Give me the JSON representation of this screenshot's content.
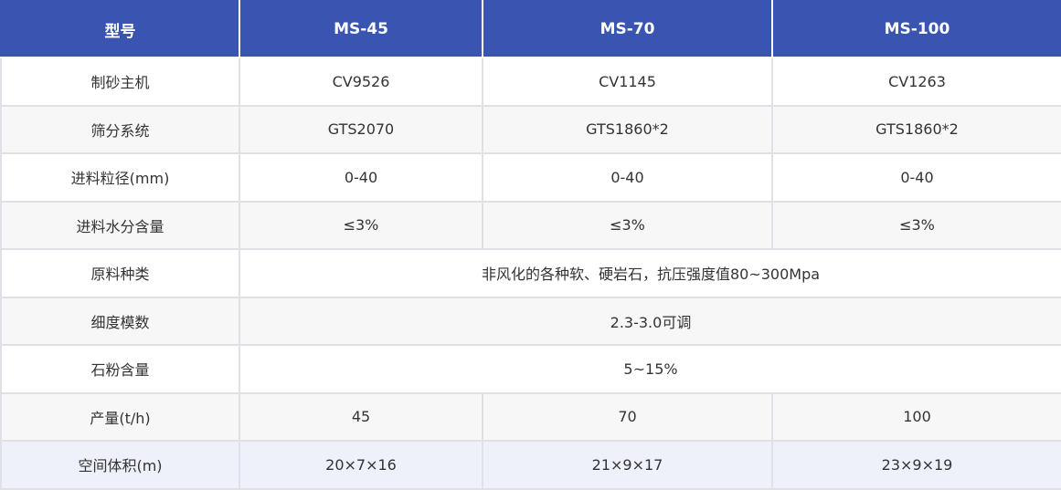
{
  "table": {
    "headers": [
      "型号",
      "MS-45",
      "MS-70",
      "MS-100"
    ],
    "rows": [
      {
        "label": "制砂主机",
        "values": [
          "CV9526",
          "CV1145",
          "CV1263"
        ]
      },
      {
        "label": "筛分系统",
        "values": [
          "GTS2070",
          "GTS1860*2",
          "GTS1860*2"
        ]
      },
      {
        "label": "进料粒径(mm)",
        "values": [
          "0-40",
          "0-40",
          "0-40"
        ]
      },
      {
        "label": "进料水分含量",
        "values": [
          "≤3%",
          "≤3%",
          "≤3%"
        ]
      },
      {
        "label": "原料种类",
        "merged": "非风化的各种软、硬岩石，抗压强度值80~300Mpa"
      },
      {
        "label": "细度模数",
        "merged": "2.3-3.0可调"
      },
      {
        "label": "石粉含量",
        "merged": "5~15%"
      },
      {
        "label": "产量(t/h)",
        "values": [
          "45",
          "70",
          "100"
        ]
      },
      {
        "label": "空间体积(m)",
        "values": [
          "20×7×16",
          "21×9×17",
          "23×9×19"
        ]
      }
    ]
  },
  "colors": {
    "header_bg": "#3a54b2",
    "header_text": "#ffffff",
    "row_alt_bg": "#f7f7f7",
    "last_row_bg": "#eef0fa",
    "border": "#dfe1e6",
    "text": "#333333"
  }
}
